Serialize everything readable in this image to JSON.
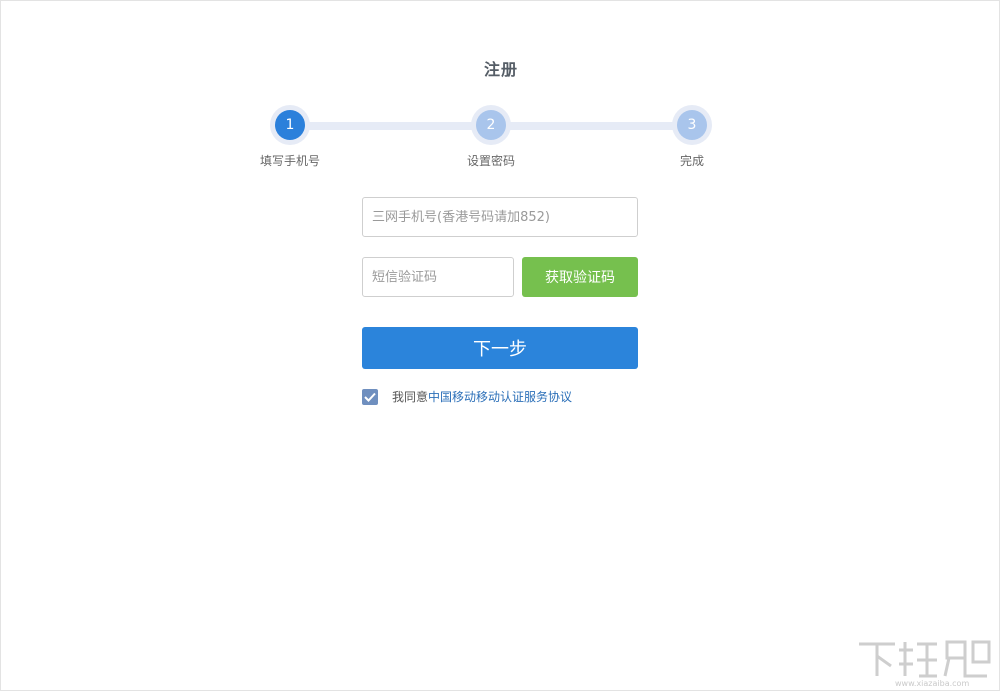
{
  "page": {
    "title": "注册"
  },
  "steps": [
    {
      "number": "1",
      "label": "填写手机号",
      "state": "active"
    },
    {
      "number": "2",
      "label": "设置密码",
      "state": "pending"
    },
    {
      "number": "3",
      "label": "完成",
      "state": "pending"
    }
  ],
  "form": {
    "phone_placeholder": "三网手机号(香港号码请加852)",
    "sms_placeholder": "短信验证码",
    "get_code_label": "获取验证码",
    "next_label": "下一步"
  },
  "agreement": {
    "checked": true,
    "prefix": "我同意",
    "link_text": "中国移动移动认证服务协议"
  },
  "watermark": {
    "text": "下载吧",
    "url_text": "www.xiazaiba.com"
  },
  "colors": {
    "active_step": "#2b80db",
    "pending_step": "#a9c5ec",
    "track": "#e6ebf6",
    "code_button": "#76c04e",
    "next_button": "#2b84db",
    "link": "#2b6fb8"
  }
}
